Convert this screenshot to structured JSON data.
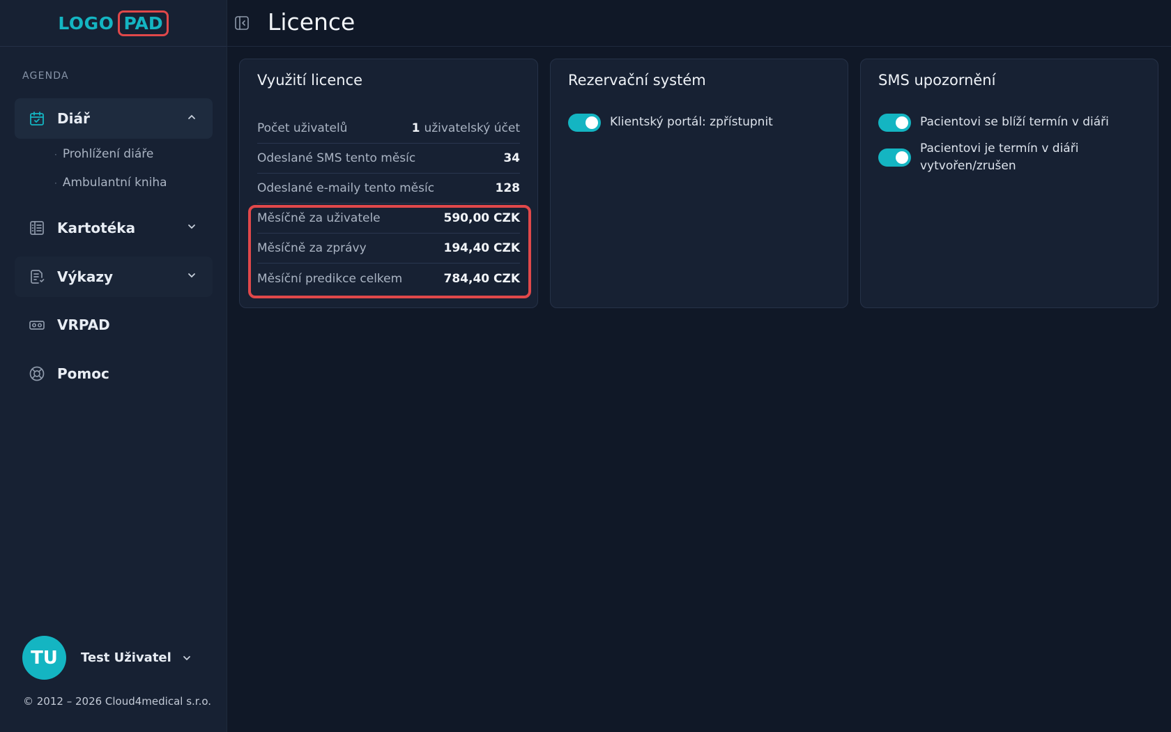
{
  "logo": {
    "part1": "LOGO",
    "part2": "PAD"
  },
  "sidebar": {
    "section": "AGENDA",
    "items": [
      {
        "label": "Diář",
        "icon": "calendar-check-icon",
        "expanded": true,
        "children": [
          "Prohlížení diáře",
          "Ambulantní kniha"
        ]
      },
      {
        "label": "Kartotéka",
        "icon": "file-index-icon"
      },
      {
        "label": "Výkazy",
        "icon": "report-icon"
      },
      {
        "label": "VRPAD",
        "icon": "vr-headset-icon"
      },
      {
        "label": "Pomoc",
        "icon": "lifebuoy-icon"
      }
    ],
    "user": {
      "initials": "TU",
      "name": "Test Uživatel"
    },
    "copyright": "© 2012 – 2026 Cloud4medical s.r.o."
  },
  "header": {
    "title": "Licence"
  },
  "license_card": {
    "title": "Využití licence",
    "rows": [
      {
        "label": "Počet uživatelů",
        "value_num": "1",
        "value_text": "uživatelský účet"
      },
      {
        "label": "Odeslané SMS tento měsíc",
        "value": "34"
      },
      {
        "label": "Odeslané e-maily tento měsíc",
        "value": "128"
      },
      {
        "label": "Měsíčně za uživatele",
        "value": "590,00 CZK"
      },
      {
        "label": "Měsíčně za zprávy",
        "value": "194,40 CZK"
      },
      {
        "label": "Měsíční predikce celkem",
        "value": "784,40 CZK"
      }
    ]
  },
  "reservation_card": {
    "title": "Rezervační systém",
    "toggles": [
      {
        "label": "Klientský portál: zpřístupnit",
        "on": true
      }
    ]
  },
  "sms_card": {
    "title": "SMS upozornění",
    "toggles": [
      {
        "label": "Pacientovi se blíží termín v diáři",
        "on": true
      },
      {
        "label": "Pacientovi je termín v diáři vytvořen/zrušen",
        "on": true
      }
    ]
  },
  "colors": {
    "accent": "#14b5c2",
    "highlight": "#e0484a",
    "background": "#101827",
    "panel": "#172133"
  }
}
